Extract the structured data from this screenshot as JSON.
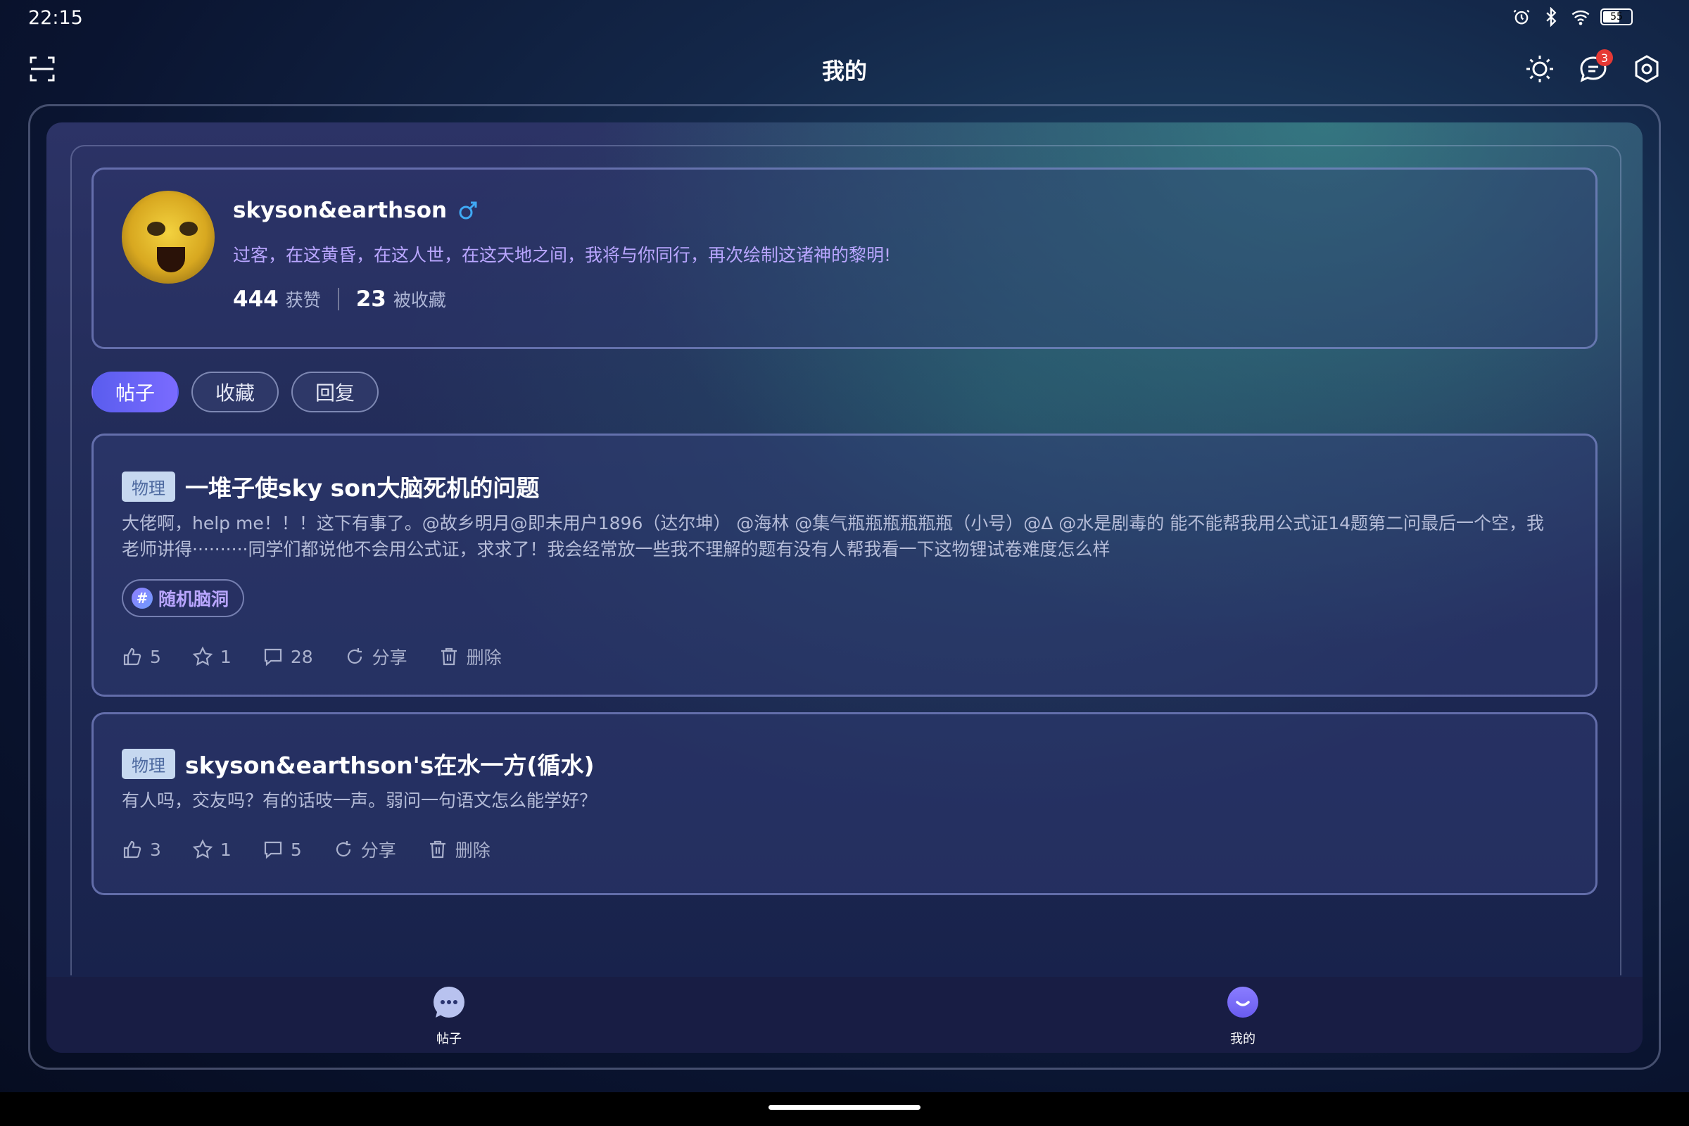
{
  "status_bar": {
    "time": "22:15",
    "battery": "55"
  },
  "header": {
    "title": "我的",
    "message_badge": "3"
  },
  "profile": {
    "username": "skyson&earthson",
    "bio": "过客，在这黄昏，在这人世，在这天地之间，我将与你同行，再次绘制这诸神的黎明!",
    "likes_count": "444",
    "likes_label": "获赞",
    "favorited_count": "23",
    "favorited_label": "被收藏"
  },
  "tabs": [
    {
      "label": "帖子",
      "active": true
    },
    {
      "label": "收藏",
      "active": false
    },
    {
      "label": "回复",
      "active": false
    }
  ],
  "posts": [
    {
      "category": "物理",
      "title": "一堆子使sky son大脑死机的问题",
      "body": "大佬啊，help me！！！这下有事了。@故乡明月@即未用户1896（达尔坤） @海林 @集气瓶瓶瓶瓶瓶瓶（小号）@Δ @水是剧毒的  能不能帮我用公式证14题第二问最后一个空，我老师讲得··········同学们都说他不会用公式证，求求了！我会经常放一些我不理解的题有没有人帮我看一下这物锂试卷难度怎么样",
      "topic": "随机脑洞",
      "likes": "5",
      "stars": "1",
      "comments": "28",
      "share_label": "分享",
      "delete_label": "删除"
    },
    {
      "category": "物理",
      "title": "skyson&earthson's在水一方(循水)",
      "body": "有人吗，交友吗？有的话吱一声。弱问一句语文怎么能学好？",
      "likes": "3",
      "stars": "1",
      "comments": "5",
      "share_label": "分享",
      "delete_label": "删除"
    }
  ],
  "bottom_nav": [
    {
      "label": "帖子",
      "icon": "chat-bubble-icon"
    },
    {
      "label": "我的",
      "icon": "profile-smile-icon"
    }
  ],
  "colors": {
    "accent": "#6a63f6",
    "bio_text": "#b9a6ff",
    "badge": "#e53935",
    "gender": "#3fa9f5"
  }
}
